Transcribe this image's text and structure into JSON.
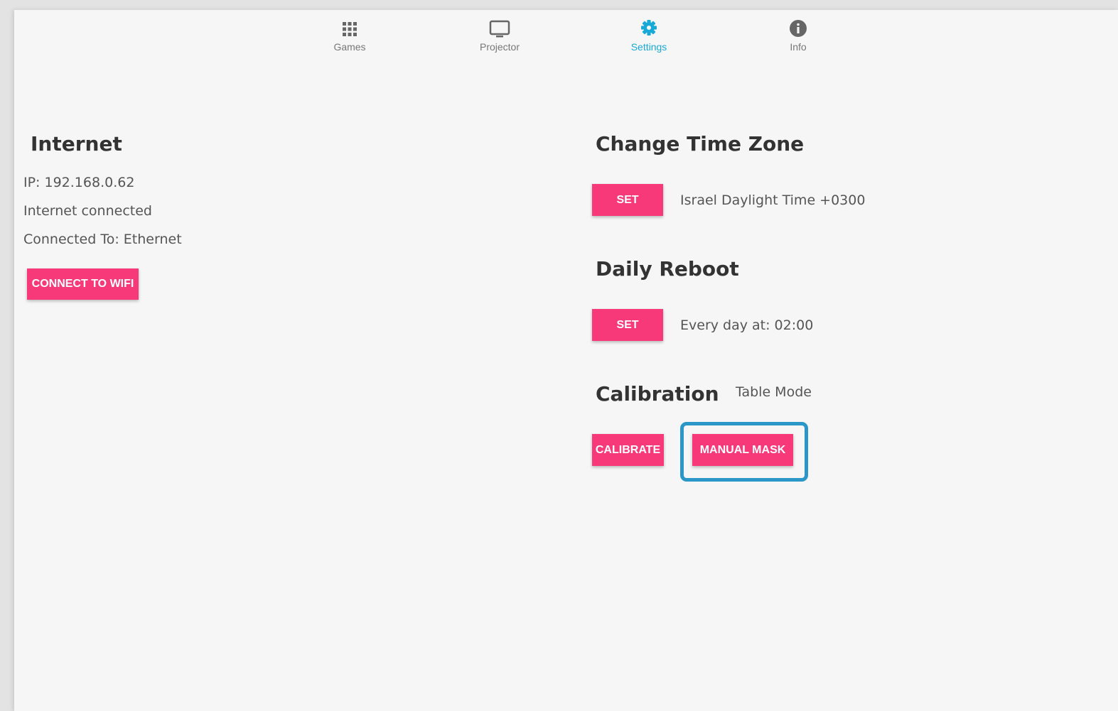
{
  "nav": {
    "items": [
      {
        "label": "Games",
        "icon": "grid-icon"
      },
      {
        "label": "Projector",
        "icon": "monitor-icon"
      },
      {
        "label": "Settings",
        "icon": "gear-icon"
      },
      {
        "label": "Info",
        "icon": "info-icon"
      }
    ],
    "active": "Settings",
    "active_color": "#19a9d6"
  },
  "internet": {
    "title": "Internet",
    "ip": "IP: 192.168.0.62",
    "status": "Internet connected",
    "connected_to": "Connected To: Ethernet",
    "connect_wifi_label": "CONNECT TO WIFI"
  },
  "timezone": {
    "title": "Change Time Zone",
    "set_label": "SET",
    "value": "Israel Daylight Time +0300"
  },
  "reboot": {
    "title": "Daily Reboot",
    "set_label": "SET",
    "value": "Every day at: 02:00"
  },
  "calibration": {
    "title": "Calibration",
    "mode": "Table Mode",
    "calibrate_label": "CALIBRATE",
    "manual_mask_label": "MANUAL MASK"
  },
  "colors": {
    "button": "#f7397a",
    "highlight": "#2b97c8"
  }
}
